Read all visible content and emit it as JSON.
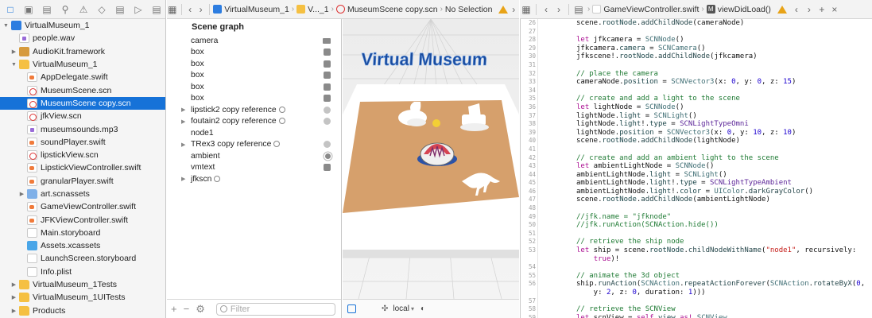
{
  "navigator": {
    "items": [
      {
        "label": "VirtualMuseum_1",
        "indent": 0,
        "disclosure": "open",
        "icon": "project-icon",
        "selected": false
      },
      {
        "label": "people.wav",
        "indent": 1,
        "disclosure": "",
        "icon": "audio-file-icon",
        "selected": false
      },
      {
        "label": "AudioKit.framework",
        "indent": 1,
        "disclosure": "closed",
        "icon": "framework-icon",
        "selected": false
      },
      {
        "label": "VirtualMuseum_1",
        "indent": 1,
        "disclosure": "open",
        "icon": "folder-icon",
        "selected": false
      },
      {
        "label": "AppDelegate.swift",
        "indent": 2,
        "disclosure": "",
        "icon": "swift-file-icon",
        "selected": false
      },
      {
        "label": "MuseumScene.scn",
        "indent": 2,
        "disclosure": "",
        "icon": "scene-file-icon",
        "selected": false
      },
      {
        "label": "MuseumScene copy.scn",
        "indent": 2,
        "disclosure": "",
        "icon": "scene-file-icon",
        "selected": true
      },
      {
        "label": "jfkView.scn",
        "indent": 2,
        "disclosure": "",
        "icon": "scene-file-icon",
        "selected": false
      },
      {
        "label": "museumsounds.mp3",
        "indent": 2,
        "disclosure": "",
        "icon": "audio-file-icon",
        "selected": false
      },
      {
        "label": "soundPlayer.swift",
        "indent": 2,
        "disclosure": "",
        "icon": "swift-file-icon",
        "selected": false
      },
      {
        "label": "lipstickView.scn",
        "indent": 2,
        "disclosure": "",
        "icon": "scene-file-icon",
        "selected": false
      },
      {
        "label": "LipstickViewController.swift",
        "indent": 2,
        "disclosure": "",
        "icon": "swift-file-icon",
        "selected": false
      },
      {
        "label": "granularPlayer.swift",
        "indent": 2,
        "disclosure": "",
        "icon": "swift-file-icon",
        "selected": false
      },
      {
        "label": "art.scnassets",
        "indent": 2,
        "disclosure": "closed",
        "icon": "blue-folder-icon",
        "selected": false
      },
      {
        "label": "GameViewController.swift",
        "indent": 2,
        "disclosure": "",
        "icon": "swift-file-icon",
        "selected": false
      },
      {
        "label": "JFKViewController.swift",
        "indent": 2,
        "disclosure": "",
        "icon": "swift-file-icon",
        "selected": false
      },
      {
        "label": "Main.storyboard",
        "indent": 2,
        "disclosure": "",
        "icon": "storyboard-file-icon",
        "selected": false
      },
      {
        "label": "Assets.xcassets",
        "indent": 2,
        "disclosure": "",
        "icon": "asset-catalog-icon",
        "selected": false
      },
      {
        "label": "LaunchScreen.storyboard",
        "indent": 2,
        "disclosure": "",
        "icon": "storyboard-file-icon",
        "selected": false
      },
      {
        "label": "Info.plist",
        "indent": 2,
        "disclosure": "",
        "icon": "plist-file-icon",
        "selected": false
      },
      {
        "label": "VirtualMuseum_1Tests",
        "indent": 1,
        "disclosure": "closed",
        "icon": "folder-icon",
        "selected": false
      },
      {
        "label": "VirtualMuseum_1UITests",
        "indent": 1,
        "disclosure": "closed",
        "icon": "folder-icon",
        "selected": false
      },
      {
        "label": "Products",
        "indent": 1,
        "disclosure": "closed",
        "icon": "folder-icon",
        "selected": false
      }
    ]
  },
  "scene_tabbar": {
    "crumbs": [
      "VirtualMuseum_1",
      "V..._1",
      "MuseumScene copy.scn",
      "No Selection"
    ]
  },
  "code_tabbar": {
    "crumbs": [
      "GameViewController.swift",
      "viewDidLoad()"
    ]
  },
  "scene_graph": {
    "title": "Scene graph",
    "nodes": [
      {
        "label": "camera",
        "expandable": false,
        "reference": false,
        "icon": "camera-icon"
      },
      {
        "label": "box",
        "expandable": false,
        "reference": false,
        "icon": "geometry-icon"
      },
      {
        "label": "box",
        "expandable": false,
        "reference": false,
        "icon": "geometry-icon"
      },
      {
        "label": "box",
        "expandable": false,
        "reference": false,
        "icon": "geometry-icon"
      },
      {
        "label": "box",
        "expandable": false,
        "reference": false,
        "icon": "geometry-icon"
      },
      {
        "label": "box",
        "expandable": false,
        "reference": false,
        "icon": "geometry-icon"
      },
      {
        "label": "lipstick2 copy reference",
        "expandable": true,
        "reference": true,
        "icon": "reference-icon"
      },
      {
        "label": "foutain2 copy reference",
        "expandable": true,
        "reference": true,
        "icon": "reference-icon"
      },
      {
        "label": "node1",
        "expandable": false,
        "reference": false,
        "icon": ""
      },
      {
        "label": "TRex3 copy reference",
        "expandable": true,
        "reference": true,
        "icon": "reference-icon"
      },
      {
        "label": "ambient",
        "expandable": false,
        "reference": false,
        "icon": "light-icon"
      },
      {
        "label": "vmtext",
        "expandable": false,
        "reference": false,
        "icon": "geometry-icon"
      },
      {
        "label": "jfkscn",
        "expandable": true,
        "reference": true,
        "icon": ""
      }
    ],
    "filter_placeholder": "Filter"
  },
  "viewport": {
    "scene_text": "Virtual Museum",
    "space_selector": "local"
  },
  "code": {
    "lines": [
      {
        "n": "26",
        "tokens": [
          [
            "pl",
            "scene."
          ],
          [
            "id",
            "rootNode"
          ],
          [
            "pl",
            "."
          ],
          [
            "fn",
            "addChildNode"
          ],
          [
            "pl",
            "(cameraNode)"
          ]
        ]
      },
      {
        "n": "27",
        "tokens": []
      },
      {
        "n": "28",
        "tokens": [
          [
            "kw",
            "let"
          ],
          [
            "pl",
            " jfkcamera = "
          ],
          [
            "ty",
            "SCNNode"
          ],
          [
            "pl",
            "()"
          ]
        ]
      },
      {
        "n": "29",
        "tokens": [
          [
            "pl",
            "jfkcamera."
          ],
          [
            "id",
            "camera"
          ],
          [
            "pl",
            " = "
          ],
          [
            "ty",
            "SCNCamera"
          ],
          [
            "pl",
            "()"
          ]
        ]
      },
      {
        "n": "30",
        "tokens": [
          [
            "pl",
            "jfkscene!."
          ],
          [
            "id",
            "rootNode"
          ],
          [
            "pl",
            "."
          ],
          [
            "fn",
            "addChildNode"
          ],
          [
            "pl",
            "(jfkcamera)"
          ]
        ]
      },
      {
        "n": "31",
        "tokens": []
      },
      {
        "n": "32",
        "tokens": [
          [
            "cm",
            "// place the camera"
          ]
        ]
      },
      {
        "n": "33",
        "tokens": [
          [
            "pl",
            "cameraNode."
          ],
          [
            "id",
            "position"
          ],
          [
            "pl",
            " = "
          ],
          [
            "ty",
            "SCNVector3"
          ],
          [
            "pl",
            "(x: "
          ],
          [
            "nu",
            "0"
          ],
          [
            "pl",
            ", y: "
          ],
          [
            "nu",
            "0"
          ],
          [
            "pl",
            ", z: "
          ],
          [
            "nu",
            "15"
          ],
          [
            "pl",
            ")"
          ]
        ]
      },
      {
        "n": "34",
        "tokens": []
      },
      {
        "n": "35",
        "tokens": [
          [
            "cm",
            "// create and add a light to the scene"
          ]
        ]
      },
      {
        "n": "36",
        "tokens": [
          [
            "kw",
            "let"
          ],
          [
            "pl",
            " lightNode = "
          ],
          [
            "ty",
            "SCNNode"
          ],
          [
            "pl",
            "()"
          ]
        ]
      },
      {
        "n": "37",
        "tokens": [
          [
            "pl",
            "lightNode."
          ],
          [
            "id",
            "light"
          ],
          [
            "pl",
            " = "
          ],
          [
            "ty",
            "SCNLight"
          ],
          [
            "pl",
            "()"
          ]
        ]
      },
      {
        "n": "38",
        "tokens": [
          [
            "pl",
            "lightNode."
          ],
          [
            "id",
            "light"
          ],
          [
            "pl",
            "!."
          ],
          [
            "id",
            "type"
          ],
          [
            "pl",
            " = "
          ],
          [
            "dt",
            "SCNLightTypeOmni"
          ]
        ]
      },
      {
        "n": "39",
        "tokens": [
          [
            "pl",
            "lightNode."
          ],
          [
            "id",
            "position"
          ],
          [
            "pl",
            " = "
          ],
          [
            "ty",
            "SCNVector3"
          ],
          [
            "pl",
            "(x: "
          ],
          [
            "nu",
            "0"
          ],
          [
            "pl",
            ", y: "
          ],
          [
            "nu",
            "10"
          ],
          [
            "pl",
            ", z: "
          ],
          [
            "nu",
            "10"
          ],
          [
            "pl",
            ")"
          ]
        ]
      },
      {
        "n": "40",
        "tokens": [
          [
            "pl",
            "scene."
          ],
          [
            "id",
            "rootNode"
          ],
          [
            "pl",
            "."
          ],
          [
            "fn",
            "addChildNode"
          ],
          [
            "pl",
            "(lightNode)"
          ]
        ]
      },
      {
        "n": "41",
        "tokens": []
      },
      {
        "n": "42",
        "tokens": [
          [
            "cm",
            "// create and add an ambient light to the scene"
          ]
        ]
      },
      {
        "n": "43",
        "tokens": [
          [
            "kw",
            "let"
          ],
          [
            "pl",
            " ambientLightNode = "
          ],
          [
            "ty",
            "SCNNode"
          ],
          [
            "pl",
            "()"
          ]
        ]
      },
      {
        "n": "44",
        "tokens": [
          [
            "pl",
            "ambientLightNode."
          ],
          [
            "id",
            "light"
          ],
          [
            "pl",
            " = "
          ],
          [
            "ty",
            "SCNLight"
          ],
          [
            "pl",
            "()"
          ]
        ]
      },
      {
        "n": "45",
        "tokens": [
          [
            "pl",
            "ambientLightNode."
          ],
          [
            "id",
            "light"
          ],
          [
            "pl",
            "!."
          ],
          [
            "id",
            "type"
          ],
          [
            "pl",
            " = "
          ],
          [
            "dt",
            "SCNLightTypeAmbient"
          ]
        ]
      },
      {
        "n": "46",
        "tokens": [
          [
            "pl",
            "ambientLightNode."
          ],
          [
            "id",
            "light"
          ],
          [
            "pl",
            "!."
          ],
          [
            "id",
            "color"
          ],
          [
            "pl",
            " = "
          ],
          [
            "ty",
            "UIColor"
          ],
          [
            "pl",
            "."
          ],
          [
            "fn",
            "darkGrayColor"
          ],
          [
            "pl",
            "()"
          ]
        ]
      },
      {
        "n": "47",
        "tokens": [
          [
            "pl",
            "scene."
          ],
          [
            "id",
            "rootNode"
          ],
          [
            "pl",
            "."
          ],
          [
            "fn",
            "addChildNode"
          ],
          [
            "pl",
            "(ambientLightNode)"
          ]
        ]
      },
      {
        "n": "48",
        "tokens": []
      },
      {
        "n": "49",
        "tokens": [
          [
            "cm",
            "//jfk.name = \"jfknode\""
          ]
        ]
      },
      {
        "n": "50",
        "tokens": [
          [
            "cm",
            "//jfk.runAction(SCNAction.hide())"
          ]
        ]
      },
      {
        "n": "51",
        "tokens": []
      },
      {
        "n": "52",
        "tokens": [
          [
            "cm",
            "// retrieve the ship node"
          ]
        ]
      },
      {
        "n": "53",
        "tokens": [
          [
            "kw",
            "let"
          ],
          [
            "pl",
            " ship = scene."
          ],
          [
            "id",
            "rootNode"
          ],
          [
            "pl",
            "."
          ],
          [
            "fn",
            "childNodeWithName"
          ],
          [
            "pl",
            "("
          ],
          [
            "st",
            "\"node1\""
          ],
          [
            "pl",
            ", recursively:"
          ]
        ]
      },
      {
        "n": "",
        "tokens": [
          [
            "pl",
            "    "
          ],
          [
            "kw",
            "true"
          ],
          [
            "pl",
            ")!"
          ]
        ]
      },
      {
        "n": "54",
        "tokens": []
      },
      {
        "n": "55",
        "tokens": [
          [
            "cm",
            "// animate the 3d object"
          ]
        ]
      },
      {
        "n": "56",
        "tokens": [
          [
            "pl",
            "ship."
          ],
          [
            "fn",
            "runAction"
          ],
          [
            "pl",
            "("
          ],
          [
            "ty",
            "SCNAction"
          ],
          [
            "pl",
            "."
          ],
          [
            "fn",
            "repeatActionForever"
          ],
          [
            "pl",
            "("
          ],
          [
            "ty",
            "SCNAction"
          ],
          [
            "pl",
            "."
          ],
          [
            "fn",
            "rotateByX"
          ],
          [
            "pl",
            "("
          ],
          [
            "nu",
            "0"
          ],
          [
            "pl",
            ","
          ]
        ]
      },
      {
        "n": "",
        "tokens": [
          [
            "pl",
            "    y: "
          ],
          [
            "nu",
            "2"
          ],
          [
            "pl",
            ", z: "
          ],
          [
            "nu",
            "0"
          ],
          [
            "pl",
            ", duration: "
          ],
          [
            "nu",
            "1"
          ],
          [
            "pl",
            ")))"
          ]
        ]
      },
      {
        "n": "57",
        "tokens": []
      },
      {
        "n": "58",
        "tokens": [
          [
            "cm",
            "// retrieve the SCNView"
          ]
        ]
      },
      {
        "n": "59",
        "tokens": [
          [
            "kw",
            "let"
          ],
          [
            "pl",
            " scnView = "
          ],
          [
            "kw",
            "self"
          ],
          [
            "pl",
            "."
          ],
          [
            "id",
            "view"
          ],
          [
            "pl",
            " "
          ],
          [
            "kw",
            "as!"
          ],
          [
            "pl",
            " "
          ],
          [
            "ty",
            "SCNView"
          ]
        ]
      }
    ]
  }
}
